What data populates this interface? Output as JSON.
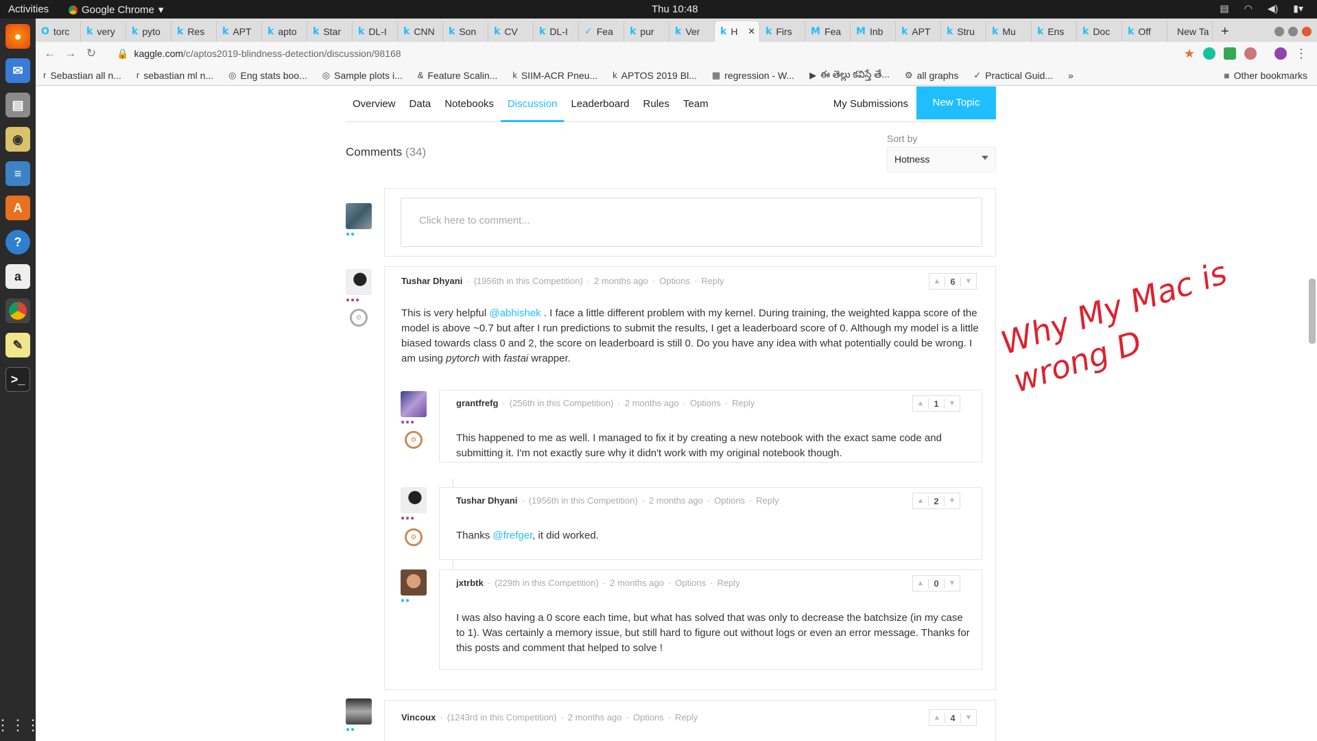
{
  "topbar": {
    "activities": "Activities",
    "app": "Google Chrome",
    "clock": "Thu 10:48"
  },
  "tabs": [
    {
      "label": "torc",
      "icon": "O"
    },
    {
      "label": "very",
      "icon": "k"
    },
    {
      "label": "pyto",
      "icon": "k"
    },
    {
      "label": "Res",
      "icon": "k"
    },
    {
      "label": "APT",
      "icon": "k"
    },
    {
      "label": "apto",
      "icon": "k"
    },
    {
      "label": "Star",
      "icon": "k"
    },
    {
      "label": "DL-I",
      "icon": "k"
    },
    {
      "label": "CNN",
      "icon": "k"
    },
    {
      "label": "Son",
      "icon": "k"
    },
    {
      "label": "CV",
      "icon": "k"
    },
    {
      "label": "DL-I",
      "icon": "k"
    },
    {
      "label": "Fea",
      "icon": "✓"
    },
    {
      "label": "pur",
      "icon": "k"
    },
    {
      "label": "Ver",
      "icon": "k"
    },
    {
      "label": "H",
      "icon": "k",
      "active": true
    },
    {
      "label": "Firs",
      "icon": "k"
    },
    {
      "label": "Fea",
      "icon": "M"
    },
    {
      "label": "Inb",
      "icon": "M"
    },
    {
      "label": "APT",
      "icon": "k"
    },
    {
      "label": "Stru",
      "icon": "k"
    },
    {
      "label": "Mu",
      "icon": "k"
    },
    {
      "label": "Ens",
      "icon": "k"
    },
    {
      "label": "Doc",
      "icon": "k"
    },
    {
      "label": "Off",
      "icon": "k"
    },
    {
      "label": "New Ta",
      "icon": ""
    }
  ],
  "url": {
    "host": "kaggle.com",
    "path": "/c/aptos2019-blindness-detection/discussion/98168"
  },
  "bookmarks": [
    {
      "label": "Sebastian all n...",
      "icon": "r"
    },
    {
      "label": "sebastian ml n...",
      "icon": "r"
    },
    {
      "label": "Eng stats boo...",
      "icon": "◎"
    },
    {
      "label": "Sample plots i...",
      "icon": "◎"
    },
    {
      "label": "Feature Scalin...",
      "icon": "&"
    },
    {
      "label": "SIIM-ACR Pneu...",
      "icon": "k"
    },
    {
      "label": "APTOS 2019 Bl...",
      "icon": "k"
    },
    {
      "label": "regression - W...",
      "icon": "▦"
    },
    {
      "label": "ఈ తెల్లు కవిస్తే తే...",
      "icon": "▶"
    },
    {
      "label": "all graphs",
      "icon": "⚙"
    },
    {
      "label": "Practical Guid...",
      "icon": "✓"
    }
  ],
  "bookmarks_more": "»",
  "other_bookmarks": "Other bookmarks",
  "nav": {
    "items": [
      "Overview",
      "Data",
      "Notebooks",
      "Discussion",
      "Leaderboard",
      "Rules",
      "Team"
    ],
    "active": "Discussion",
    "my_submissions": "My Submissions",
    "new_topic": "New Topic"
  },
  "comments_title": "Comments",
  "comments_count": "(34)",
  "sort": {
    "label": "Sort by",
    "value": "Hotness"
  },
  "comment_placeholder": "Click here to comment...",
  "comments": [
    {
      "author": "Tushar Dhyani",
      "rank": "(1956th in this Competition)",
      "time": "2 months ago",
      "options": "Options",
      "reply": "Reply",
      "votes": "6",
      "text_parts": [
        "This is very helpful ",
        "@abhishek",
        " . I face a little different problem with my kernel. During training, the weighted kappa score of the model is above ~0.7 but after I run predictions to submit the results, I get a leaderboard score of 0. Although my model is a little biased towards class 0 and 2, the score on leaderboard is still 0. Do you have any idea with what potentially could be wrong. I am using ",
        "pytorch",
        " with ",
        "fastai",
        " wrapper."
      ]
    },
    {
      "author": "grantfrefg",
      "rank": "(256th in this Competition)",
      "time": "2 months ago",
      "options": "Options",
      "reply": "Reply",
      "votes": "1",
      "text": "This happened to me as well. I managed to fix it by creating a new notebook with the exact same code and submitting it. I'm not exactly sure why it didn't work with my original notebook though."
    },
    {
      "author": "Tushar Dhyani",
      "rank": "(1956th in this Competition)",
      "time": "2 months ago",
      "options": "Options",
      "reply": "Reply",
      "votes": "2",
      "text_a": "Thanks ",
      "mention": "@frefger",
      "text_b": ", it did worked."
    },
    {
      "author": "jxtrbtk",
      "rank": "(229th in this Competition)",
      "time": "2 months ago",
      "options": "Options",
      "reply": "Reply",
      "votes": "0",
      "text": "I was also having a 0 score each time, but what has solved that was only to decrease the batchsize (in my case to 1). Was certainly a memory issue, but still hard to figure out without logs or even an error message. Thanks for this posts and comment that helped to solve !"
    },
    {
      "author": "Vincoux",
      "rank": "(1243rd in this Competition)",
      "time": "2 months ago",
      "options": "Options",
      "reply": "Reply",
      "votes": "4"
    }
  ],
  "annotation": "Why My Mac is wrong D",
  "colors": {
    "accent": "#20beff",
    "annotation": "#e0202e"
  }
}
